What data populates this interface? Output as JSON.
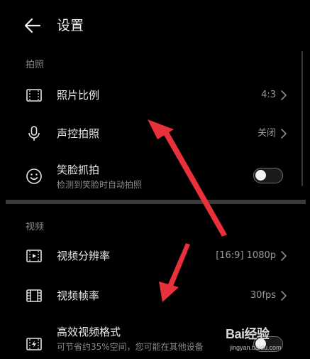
{
  "header": {
    "title": "设置",
    "back_icon": "arrow-left-icon"
  },
  "sections": {
    "photo": {
      "label": "拍照",
      "items": [
        {
          "title": "照片比例",
          "value": "4:3",
          "icon": "aspect-ratio-icon"
        },
        {
          "title": "声控拍照",
          "value": "关闭",
          "icon": "microphone-icon"
        },
        {
          "title": "笑脸抓拍",
          "subtitle": "检测到笑脸时自动拍照",
          "icon": "smile-icon",
          "toggle_on": false
        }
      ]
    },
    "video": {
      "label": "视频",
      "items": [
        {
          "title": "视频分辨率",
          "value": "[16:9] 1080p",
          "icon": "video-resolution-icon"
        },
        {
          "title": "视频帧率",
          "value": "30fps",
          "icon": "film-icon"
        },
        {
          "title": "高效视频格式",
          "subtitle": "可节省约35%空间，您可能在其他设备",
          "icon": "efficient-video-icon",
          "toggle_on": false
        }
      ]
    }
  },
  "colors": {
    "background": "#000000",
    "text_primary": "#ececec",
    "text_secondary": "#8a8a8a",
    "annotation_arrow": "#e8313a"
  },
  "watermark": {
    "brand": "Bai经验",
    "url": "jingyan.baidu.com"
  }
}
